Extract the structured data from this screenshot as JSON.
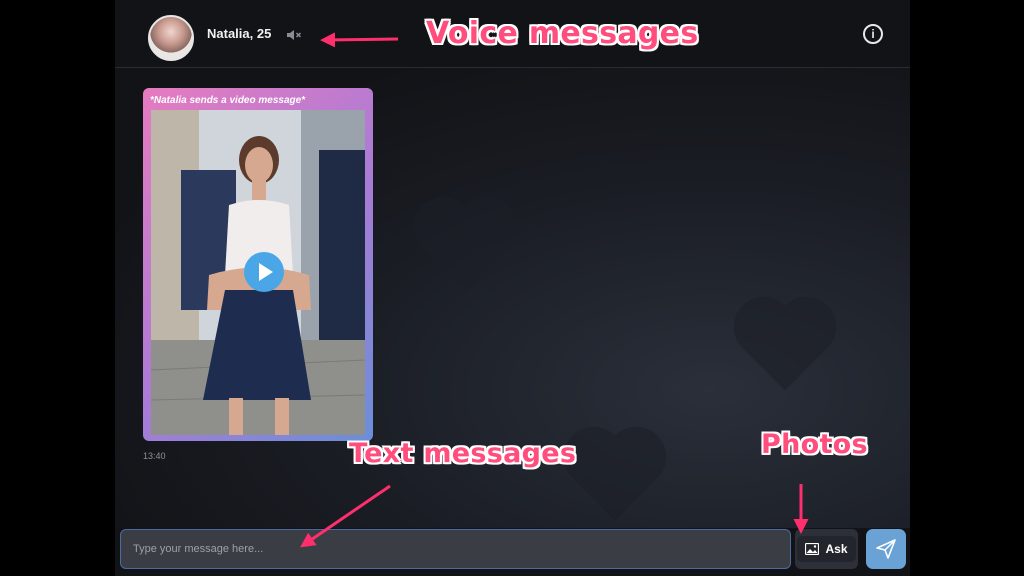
{
  "header": {
    "contact_name": "Natalia, 25",
    "icons": {
      "avatar": "avatar",
      "mute": "speaker-muted-icon",
      "info": "info-icon"
    },
    "info_glyph": "i"
  },
  "message": {
    "caption": "*Natalia sends a video message*",
    "time": "13:40",
    "icon": "play-icon"
  },
  "composer": {
    "placeholder": "Type your message here...",
    "ask_label": "Ask",
    "ask_icon": "image-icon",
    "send_icon": "send-icon"
  },
  "annotations": {
    "voice": "Voice messages",
    "text": "Text messages",
    "photos": "Photos"
  },
  "colors": {
    "annotation": "#ff4d7d",
    "send_button": "#6aa2d6",
    "play_button": "#4aa6e6"
  }
}
